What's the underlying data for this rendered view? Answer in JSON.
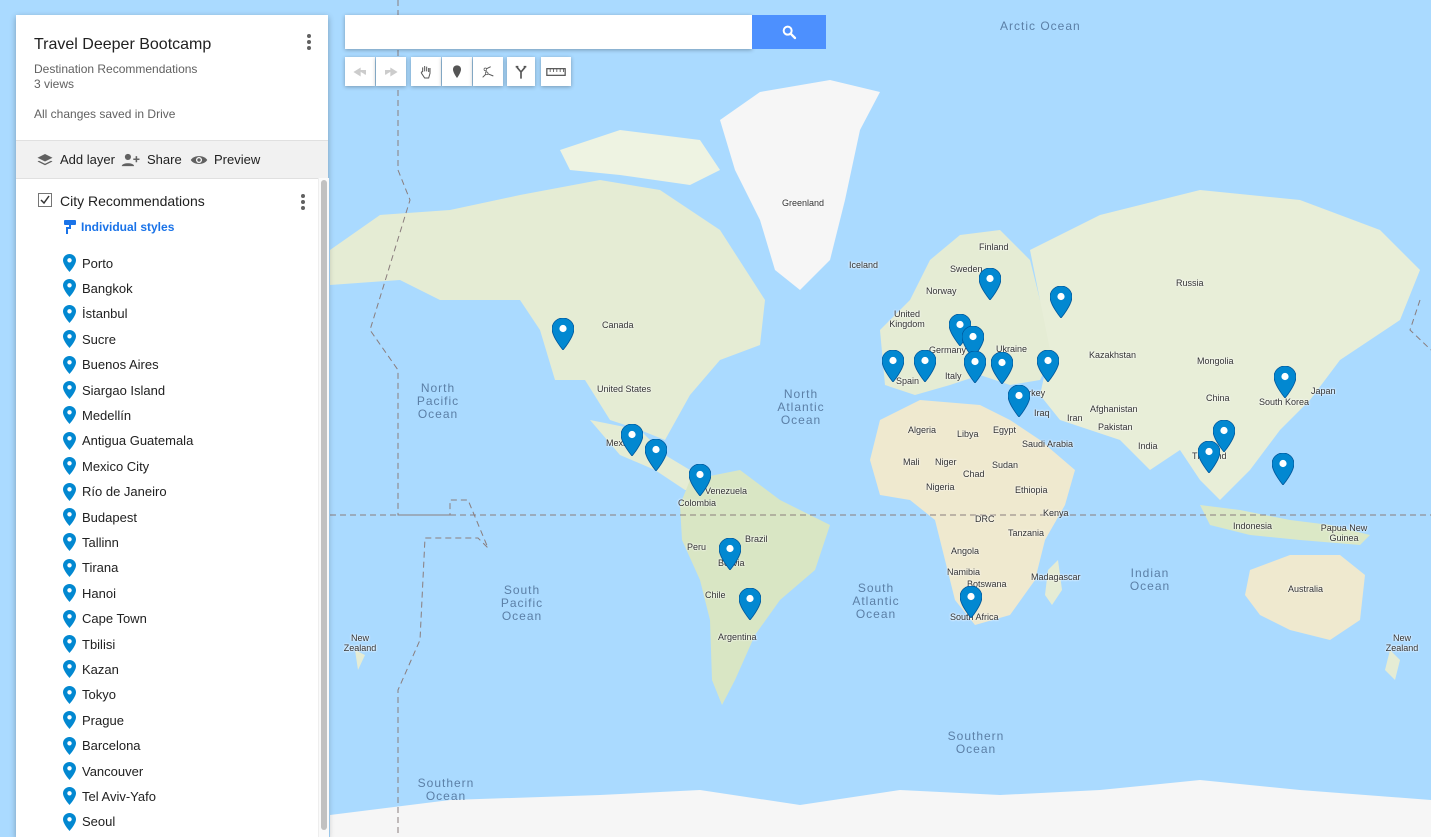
{
  "header": {
    "title": "Travel Deeper Bootcamp",
    "subtitle": "Destination Recommendations",
    "views": "3 views",
    "save_status": "All changes saved in Drive"
  },
  "toolbar": {
    "add_layer": "Add layer",
    "share": "Share",
    "preview": "Preview"
  },
  "layer": {
    "title": "City Recommendations",
    "style_label": "Individual styles",
    "checked": true,
    "items": [
      "Porto",
      "Bangkok",
      "İstanbul",
      "Sucre",
      "Buenos Aires",
      "Siargao Island",
      "Medellín",
      "Antigua Guatemala",
      "Mexico City",
      "Río de Janeiro",
      "Budapest",
      "Tallinn",
      "Tirana",
      "Hanoi",
      "Cape Town",
      "Tbilisi",
      "Kazan",
      "Tokyo",
      "Prague",
      "Barcelona",
      "Vancouver",
      "Tel Aviv-Yafo",
      "Seoul"
    ]
  },
  "search": {
    "placeholder": "",
    "value": ""
  },
  "map": {
    "pin_color": "#0288d1",
    "land_color": "#e8efd8",
    "water_color": "#aadaff",
    "ocean_labels": [
      "Arctic Ocean",
      "North Pacific Ocean",
      "North Atlantic Ocean",
      "South Pacific Ocean",
      "South Atlantic Ocean",
      "Indian Ocean",
      "Southern Ocean",
      "Southern Ocean"
    ],
    "place_labels": [
      "Greenland",
      "Iceland",
      "Finland",
      "Sweden",
      "Norway",
      "Russia",
      "United Kingdom",
      "Germany",
      "Ukraine",
      "Kazakhstan",
      "Mongolia",
      "Spain",
      "Italy",
      "Turkey",
      "China",
      "Japan",
      "South Korea",
      "Iraq",
      "Iran",
      "Afghanistan",
      "Pakistan",
      "India",
      "Thailand",
      "Algeria",
      "Libya",
      "Egypt",
      "Saudi Arabia",
      "Mali",
      "Niger",
      "Chad",
      "Sudan",
      "Ethiopia",
      "Nigeria",
      "Kenya",
      "DRC",
      "Tanzania",
      "Angola",
      "Namibia",
      "Botswana",
      "Madagascar",
      "South Africa",
      "Indonesia",
      "Papua New Guinea",
      "Australia",
      "Canada",
      "United States",
      "Mexico",
      "Venezuela",
      "Colombia",
      "Brazil",
      "Peru",
      "Bolivia",
      "Chile",
      "Argentina",
      "New Zealand",
      "New Zealand"
    ]
  }
}
